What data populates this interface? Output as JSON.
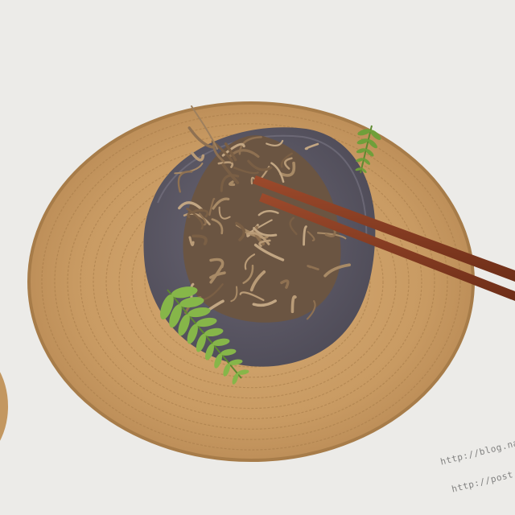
{
  "photo": {
    "watermark_lines": [
      "http://blog.naver.co",
      "http://post.naver.co"
    ]
  },
  "colors": {
    "background": "#ecebe8",
    "rattan_mat": "#c89a62",
    "stone_plate": "#5d5a66",
    "noodles": "#8a6c4e",
    "chopsticks": "#8a3b22",
    "fern": "#7fae43"
  }
}
